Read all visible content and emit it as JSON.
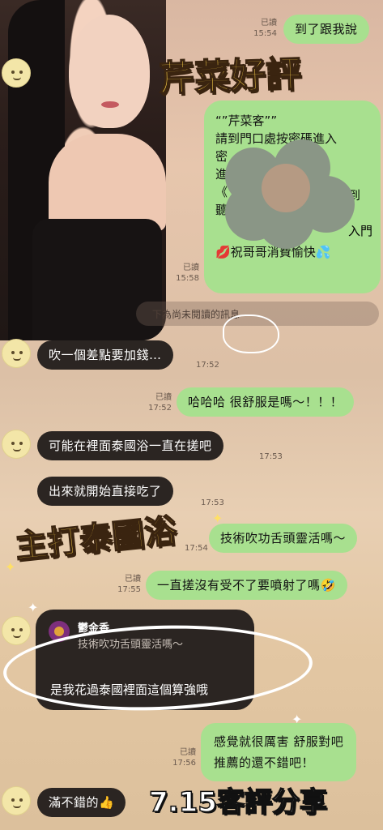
{
  "messages": [
    {
      "id": "m1",
      "dir": "out",
      "text": "到了跟我說",
      "read": "已讀",
      "time": "15:54"
    },
    {
      "id": "m3",
      "dir": "out",
      "read": "已讀",
      "time": "15:58"
    },
    {
      "id": "m4",
      "dir": "in",
      "text": "吹一個差點要加錢…",
      "time": "17:52"
    },
    {
      "id": "m5",
      "dir": "out",
      "text": "哈哈哈 很舒服是嗎〜！！！",
      "read": "已讀",
      "time": "17:52"
    },
    {
      "id": "m6",
      "dir": "in",
      "text": "可能在裡面泰國浴一直在搓吧",
      "time": "17:53"
    },
    {
      "id": "m7",
      "dir": "in",
      "text": "出來就開始直接吃了",
      "time": "17:53"
    },
    {
      "id": "m8",
      "dir": "out",
      "text": "技術吹功舌頭靈活嗎〜",
      "time": "17:54"
    },
    {
      "id": "m9",
      "dir": "out",
      "text": "一直搓沒有受不了要噴射了嗎",
      "read": "已讀",
      "time": "17:55"
    },
    {
      "id": "m10",
      "dir": "out",
      "line1": "感覺就很厲害 舒服對吧",
      "line2": "推薦的還不錯吧！",
      "read": "已讀",
      "time": "17:56"
    },
    {
      "id": "m11",
      "dir": "in",
      "text": "滿不錯的"
    }
  ],
  "big_bubble": {
    "lines": [
      "“”芹菜客””",
      "請到門口處按密碼進入",
      "密",
      "進",
      "《",
      "聽",
      "祝哥哥消費愉快"
    ],
    "frag_right": [
      "到",
      "入門"
    ]
  },
  "hidden_notice": "下為尚未閱讀的訊息",
  "reply": {
    "name": "鬱金香",
    "quote": "技術吹功舌頭靈活嗎〜",
    "text": "是我花過泰國裡面這個算強哦"
  },
  "stickers": {
    "top": "芹菜好評",
    "mid": "主打泰國浴",
    "bottom": "7.15客評分享"
  },
  "icons": {
    "avatar": "smiley-avatar-icon",
    "kiss": "lips-icon",
    "sweat": "sweat-droplets-icon",
    "laugh": "rofl-emoji-icon",
    "thumbs": "thumbs-up-icon"
  }
}
